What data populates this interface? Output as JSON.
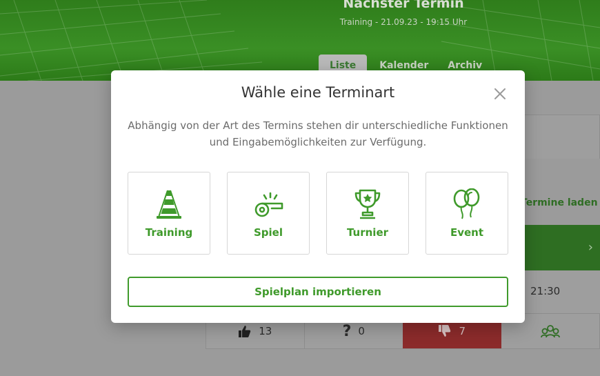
{
  "page": {
    "next_event_title": "Nächster Termin",
    "next_event_sub": "Training - 21.09.23 - 19:15 Uhr",
    "tabs": [
      {
        "label": "Liste"
      },
      {
        "label": "Kalender"
      },
      {
        "label": "Archiv"
      }
    ],
    "reload_label": "Termine laden",
    "event_time": "21:30",
    "votes": {
      "yes_count": "13",
      "maybe_symbol": "?",
      "maybe_count": "0",
      "no_count": "7"
    }
  },
  "modal": {
    "title": "Wähle eine Terminart",
    "description": "Abhängig von der Art des Termins stehen dir unterschiedliche Funktionen und Eingabemöglichkeiten zur Verfügung.",
    "types": [
      {
        "label": "Training",
        "icon": "cone-icon"
      },
      {
        "label": "Spiel",
        "icon": "whistle-icon"
      },
      {
        "label": "Turnier",
        "icon": "trophy-icon"
      },
      {
        "label": "Event",
        "icon": "balloons-icon"
      }
    ],
    "import_label": "Spielplan importieren"
  },
  "colors": {
    "accent": "#3f9a2b",
    "hero": "#3a8f25",
    "overlay": "#9b9b9b",
    "negative": "#8b2b2b"
  }
}
